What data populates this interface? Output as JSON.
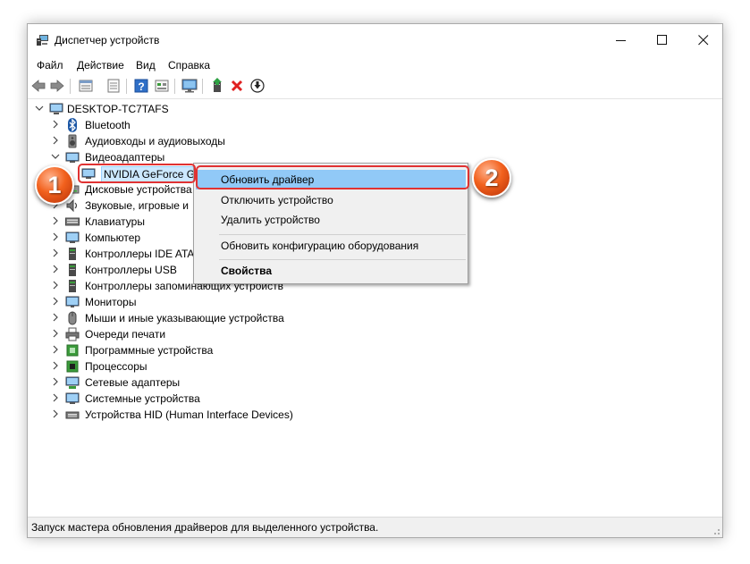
{
  "window": {
    "title": "Диспетчер устройств",
    "icon": "device-manager-icon",
    "controls": [
      "minimize-icon",
      "maximize-icon",
      "close-icon"
    ]
  },
  "menu": [
    "Файл",
    "Действие",
    "Вид",
    "Справка"
  ],
  "toolbar": [
    "back-arrow-icon",
    "forward-arrow-icon",
    "properties-list-icon",
    "document-icon",
    "help-icon",
    "details-view-icon",
    "monitor-scan-icon",
    "update-driver-icon",
    "remove-device-icon",
    "download-circle-icon"
  ],
  "tree": {
    "root": "DESKTOP-TC7TAFS",
    "items": [
      {
        "label": "Bluetooth",
        "icon": "bluetooth-icon",
        "expanded": false
      },
      {
        "label": "Аудиовходы и аудиовыходы",
        "icon": "speaker-icon",
        "expanded": false
      },
      {
        "label": "Видеоадаптеры",
        "icon": "display-adapter-icon",
        "expanded": true
      },
      {
        "label": "NVIDIA GeForce GT",
        "icon": "gpu-card-icon",
        "child": true
      },
      {
        "label": "Дисковые устройства",
        "icon": "disk-drive-icon",
        "expanded": false
      },
      {
        "label": "Звуковые, игровые и",
        "icon": "sound-card-icon",
        "expanded": false
      },
      {
        "label": "Клавиатуры",
        "icon": "keyboard-icon",
        "expanded": false
      },
      {
        "label": "Компьютер",
        "icon": "computer-icon",
        "expanded": false
      },
      {
        "label": "Контроллеры IDE ATA",
        "icon": "ide-controller-icon",
        "expanded": false
      },
      {
        "label": "Контроллеры USB",
        "icon": "usb-icon",
        "expanded": false
      },
      {
        "label": "Контроллеры запоминающих устройств",
        "icon": "storage-controller-icon",
        "expanded": false
      },
      {
        "label": "Мониторы",
        "icon": "monitor-icon",
        "expanded": false
      },
      {
        "label": "Мыши и иные указывающие устройства",
        "icon": "mouse-icon",
        "expanded": false
      },
      {
        "label": "Очереди печати",
        "icon": "printer-icon",
        "expanded": false
      },
      {
        "label": "Программные устройства",
        "icon": "software-device-icon",
        "expanded": false
      },
      {
        "label": "Процессоры",
        "icon": "processor-icon",
        "expanded": false
      },
      {
        "label": "Сетевые адаптеры",
        "icon": "network-adapter-icon",
        "expanded": false
      },
      {
        "label": "Системные устройства",
        "icon": "system-device-icon",
        "expanded": false
      },
      {
        "label": "Устройства HID (Human Interface Devices)",
        "icon": "hid-icon",
        "expanded": false
      }
    ]
  },
  "context_menu": {
    "items": [
      "Обновить драйвер",
      "Отключить устройство",
      "Удалить устройство",
      "Обновить конфигурацию оборудования",
      "Свойства"
    ],
    "highlighted": "Обновить драйвер"
  },
  "annotations": {
    "badge_1": "1",
    "badge_2": "2",
    "color": "#e03232"
  },
  "status": "Запуск мастера обновления драйверов для выделенного устройства.",
  "colors": {
    "highlight": "#91c9f7",
    "badge": "#f2611d",
    "menu_bg": "#f0f0f0"
  }
}
